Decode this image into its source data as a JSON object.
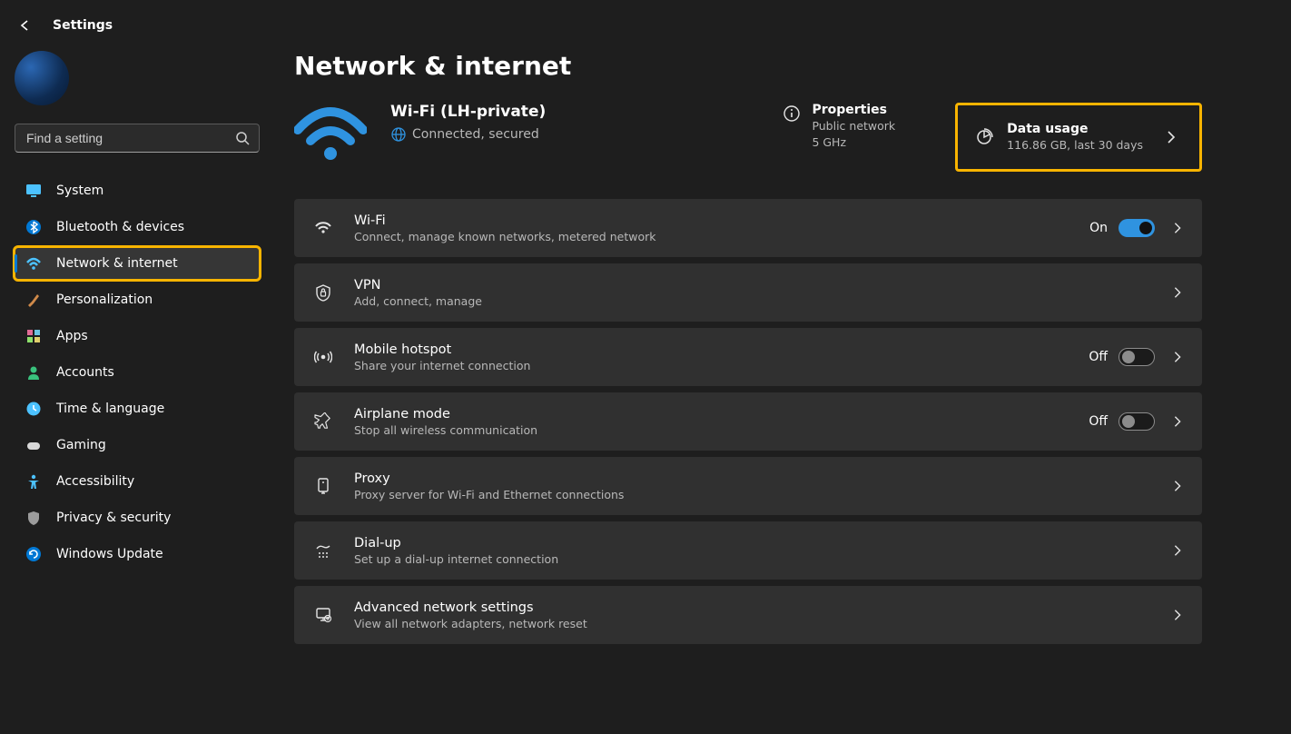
{
  "app_title": "Settings",
  "search": {
    "placeholder": "Find a setting"
  },
  "sidebar": {
    "items": [
      {
        "id": "system",
        "label": "System",
        "icon": "monitor-icon",
        "iconColor": "#4cc2ff"
      },
      {
        "id": "bluetooth",
        "label": "Bluetooth & devices",
        "icon": "bluetooth-icon",
        "iconColor": "#0078d4"
      },
      {
        "id": "network",
        "label": "Network & internet",
        "icon": "wifi-icon",
        "iconColor": "#4cc2ff",
        "selected": true,
        "highlighted": true
      },
      {
        "id": "personalization",
        "label": "Personalization",
        "icon": "brush-icon",
        "iconColor": "#d08a4a"
      },
      {
        "id": "apps",
        "label": "Apps",
        "icon": "apps-icon",
        "iconColor": "#e06b95"
      },
      {
        "id": "accounts",
        "label": "Accounts",
        "icon": "person-icon",
        "iconColor": "#39c27d"
      },
      {
        "id": "time",
        "label": "Time & language",
        "icon": "clock-icon",
        "iconColor": "#4cc2ff"
      },
      {
        "id": "gaming",
        "label": "Gaming",
        "icon": "gamepad-icon",
        "iconColor": "#d9d9d9"
      },
      {
        "id": "accessibility",
        "label": "Accessibility",
        "icon": "accessibility-icon",
        "iconColor": "#4cc2ff"
      },
      {
        "id": "privacy",
        "label": "Privacy & security",
        "icon": "shield-icon",
        "iconColor": "#9c9c9c"
      },
      {
        "id": "update",
        "label": "Windows Update",
        "icon": "update-icon",
        "iconColor": "#0078d4"
      }
    ]
  },
  "page": {
    "title": "Network & internet",
    "status": {
      "name": "Wi-Fi (LH-private)",
      "state": "Connected, secured"
    },
    "properties": {
      "title": "Properties",
      "line1": "Public network",
      "line2": "5 GHz"
    },
    "data_usage": {
      "title": "Data usage",
      "sub": "116.86 GB, last 30 days"
    },
    "items": [
      {
        "id": "wifi",
        "title": "Wi-Fi",
        "sub": "Connect, manage known networks, metered network",
        "icon": "wifi",
        "toggle": "On",
        "chevron": true
      },
      {
        "id": "vpn",
        "title": "VPN",
        "sub": "Add, connect, manage",
        "icon": "shield-lock",
        "chevron": true
      },
      {
        "id": "hotspot",
        "title": "Mobile hotspot",
        "sub": "Share your internet connection",
        "icon": "hotspot",
        "toggle": "Off",
        "chevron": true
      },
      {
        "id": "airplane",
        "title": "Airplane mode",
        "sub": "Stop all wireless communication",
        "icon": "airplane",
        "toggle": "Off",
        "chevron": true
      },
      {
        "id": "proxy",
        "title": "Proxy",
        "sub": "Proxy server for Wi-Fi and Ethernet connections",
        "icon": "proxy",
        "chevron": true
      },
      {
        "id": "dialup",
        "title": "Dial-up",
        "sub": "Set up a dial-up internet connection",
        "icon": "dialup",
        "chevron": true
      },
      {
        "id": "advanced",
        "title": "Advanced network settings",
        "sub": "View all network adapters, network reset",
        "icon": "advanced",
        "chevron": true
      }
    ]
  }
}
